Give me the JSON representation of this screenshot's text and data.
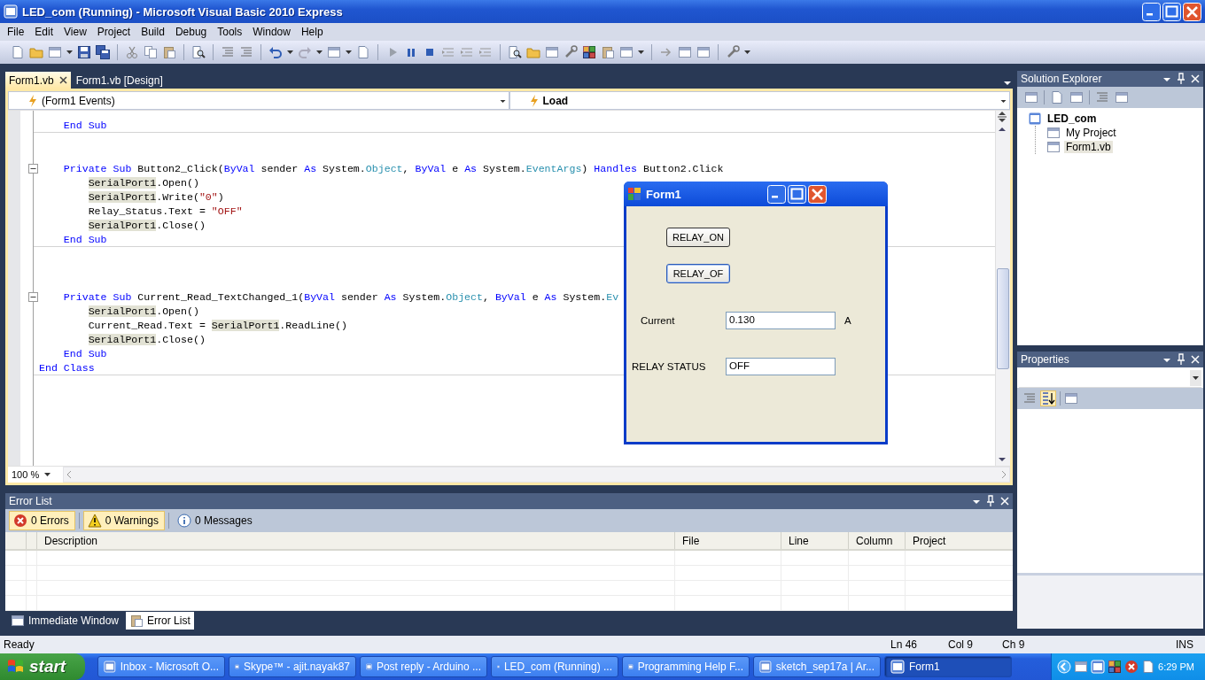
{
  "window": {
    "title": "LED_com (Running) - Microsoft Visual Basic 2010 Express"
  },
  "menu": [
    "File",
    "Edit",
    "View",
    "Project",
    "Build",
    "Debug",
    "Tools",
    "Window",
    "Help"
  ],
  "doc_tabs": [
    {
      "label": "Form1.vb",
      "selected": true
    },
    {
      "label": "Form1.vb [Design]",
      "selected": false
    }
  ],
  "editor": {
    "object_dropdown": "(Form1 Events)",
    "member_dropdown": "Load",
    "zoom": "100 %",
    "lines": [
      {
        "kind": "member",
        "separator": true,
        "tokens": [
          {
            "kind": "kw",
            "text": "End Sub"
          }
        ]
      },
      {
        "kind": "blank"
      },
      {
        "kind": "blank"
      },
      {
        "kind": "member",
        "fold": true,
        "expanded": true,
        "tokens": [
          {
            "kind": "kw",
            "text": "Private Sub"
          },
          {
            "kind": "p",
            "text": " Button2_Click("
          },
          {
            "kind": "kw",
            "text": "ByVal"
          },
          {
            "kind": "p",
            "text": " sender "
          },
          {
            "kind": "kw",
            "text": "As"
          },
          {
            "kind": "p",
            "text": " System."
          },
          {
            "kind": "type",
            "text": "Object"
          },
          {
            "kind": "p",
            "text": ", "
          },
          {
            "kind": "kw",
            "text": "ByVal"
          },
          {
            "kind": "p",
            "text": " e "
          },
          {
            "kind": "kw",
            "text": "As"
          },
          {
            "kind": "p",
            "text": " System."
          },
          {
            "kind": "type",
            "text": "EventArgs"
          },
          {
            "kind": "p",
            "text": ") "
          },
          {
            "kind": "kw",
            "text": "Handles"
          },
          {
            "kind": "p",
            "text": " Button2.Click"
          }
        ]
      },
      {
        "kind": "statement",
        "tokens": [
          {
            "kind": "hl",
            "text": "SerialPort1"
          },
          {
            "kind": "p",
            "text": ".Open()"
          }
        ]
      },
      {
        "kind": "statement",
        "tokens": [
          {
            "kind": "hl",
            "text": "SerialPort1"
          },
          {
            "kind": "p",
            "text": ".Write("
          },
          {
            "kind": "str",
            "text": "\"0\""
          },
          {
            "kind": "p",
            "text": ")"
          }
        ]
      },
      {
        "kind": "statement",
        "tokens": [
          {
            "kind": "p",
            "text": "Relay_Status.Text = "
          },
          {
            "kind": "str",
            "text": "\"OFF\""
          }
        ]
      },
      {
        "kind": "statement",
        "tokens": [
          {
            "kind": "hl",
            "text": "SerialPort1"
          },
          {
            "kind": "p",
            "text": ".Close()"
          }
        ]
      },
      {
        "kind": "member",
        "separator": true,
        "tokens": [
          {
            "kind": "kw",
            "text": "End Sub"
          }
        ]
      },
      {
        "kind": "blank"
      },
      {
        "kind": "blank"
      },
      {
        "kind": "blank"
      },
      {
        "kind": "member",
        "fold": true,
        "expanded": true,
        "tokens": [
          {
            "kind": "kw",
            "text": "Private Sub"
          },
          {
            "kind": "p",
            "text": " Current_Read_TextChanged_1("
          },
          {
            "kind": "kw",
            "text": "ByVal"
          },
          {
            "kind": "p",
            "text": " sender "
          },
          {
            "kind": "kw",
            "text": "As"
          },
          {
            "kind": "p",
            "text": " System."
          },
          {
            "kind": "type",
            "text": "Object"
          },
          {
            "kind": "p",
            "text": ", "
          },
          {
            "kind": "kw",
            "text": "ByVal"
          },
          {
            "kind": "p",
            "text": " e "
          },
          {
            "kind": "kw",
            "text": "As"
          },
          {
            "kind": "p",
            "text": " System."
          },
          {
            "kind": "type",
            "text": "Ev"
          }
        ]
      },
      {
        "kind": "statement",
        "tokens": [
          {
            "kind": "hl",
            "text": "SerialPort1"
          },
          {
            "kind": "p",
            "text": ".Open()"
          }
        ]
      },
      {
        "kind": "statement",
        "tokens": [
          {
            "kind": "p",
            "text": "Current_Read.Text = "
          },
          {
            "kind": "hl",
            "text": "SerialPort1"
          },
          {
            "kind": "p",
            "text": ".ReadLine()"
          }
        ]
      },
      {
        "kind": "statement",
        "tokens": [
          {
            "kind": "hl",
            "text": "SerialPort1"
          },
          {
            "kind": "p",
            "text": ".Close()"
          }
        ]
      },
      {
        "kind": "member",
        "tokens": [
          {
            "kind": "kw",
            "text": "End Sub"
          }
        ]
      },
      {
        "kind": "class",
        "separator": true,
        "tokens": [
          {
            "kind": "kw",
            "text": "End Class"
          }
        ]
      }
    ]
  },
  "form_window": {
    "title": "Form1",
    "buttons": [
      "RELAY_ON",
      "RELAY_OF"
    ],
    "fields": [
      {
        "label": "Current",
        "value": "0.130",
        "unit": "A"
      },
      {
        "label": "RELAY STATUS",
        "value": "OFF"
      }
    ]
  },
  "solution_explorer": {
    "title": "Solution Explorer",
    "tree": [
      {
        "label": "LED_com",
        "expanded": true,
        "selected": false,
        "children": [
          {
            "label": "My Project",
            "selected": false
          },
          {
            "label": "Form1.vb",
            "selected": true
          }
        ]
      }
    ]
  },
  "properties": {
    "title": "Properties"
  },
  "error_list": {
    "title": "Error List",
    "filters": [
      {
        "kind": "error",
        "label": "0 Errors",
        "on": true
      },
      {
        "kind": "warning",
        "label": "0 Warnings",
        "on": true
      },
      {
        "kind": "info",
        "label": "0 Messages",
        "on": false
      }
    ],
    "columns": [
      "Description",
      "File",
      "Line",
      "Column",
      "Project"
    ]
  },
  "bottom_tabs": [
    {
      "label": "Immediate Window",
      "selected": false
    },
    {
      "label": "Error List",
      "selected": true
    }
  ],
  "status_bar": {
    "status": "Ready",
    "line": "Ln 46",
    "column": "Col 9",
    "char": "Ch 9",
    "mode": "INS"
  },
  "taskbar": {
    "start": "start",
    "clock": "6:29 PM",
    "items": [
      {
        "label": "Inbox - Microsoft O...",
        "selected": false
      },
      {
        "label": "Skype™ - ajit.nayak87",
        "selected": false
      },
      {
        "label": "Post reply - Arduino ...",
        "selected": false
      },
      {
        "label": "LED_com (Running) ...",
        "selected": false
      },
      {
        "label": "Programming Help F...",
        "selected": false
      },
      {
        "label": "sketch_sep17a | Ar...",
        "selected": false
      },
      {
        "label": "Form1",
        "selected": true
      }
    ]
  }
}
